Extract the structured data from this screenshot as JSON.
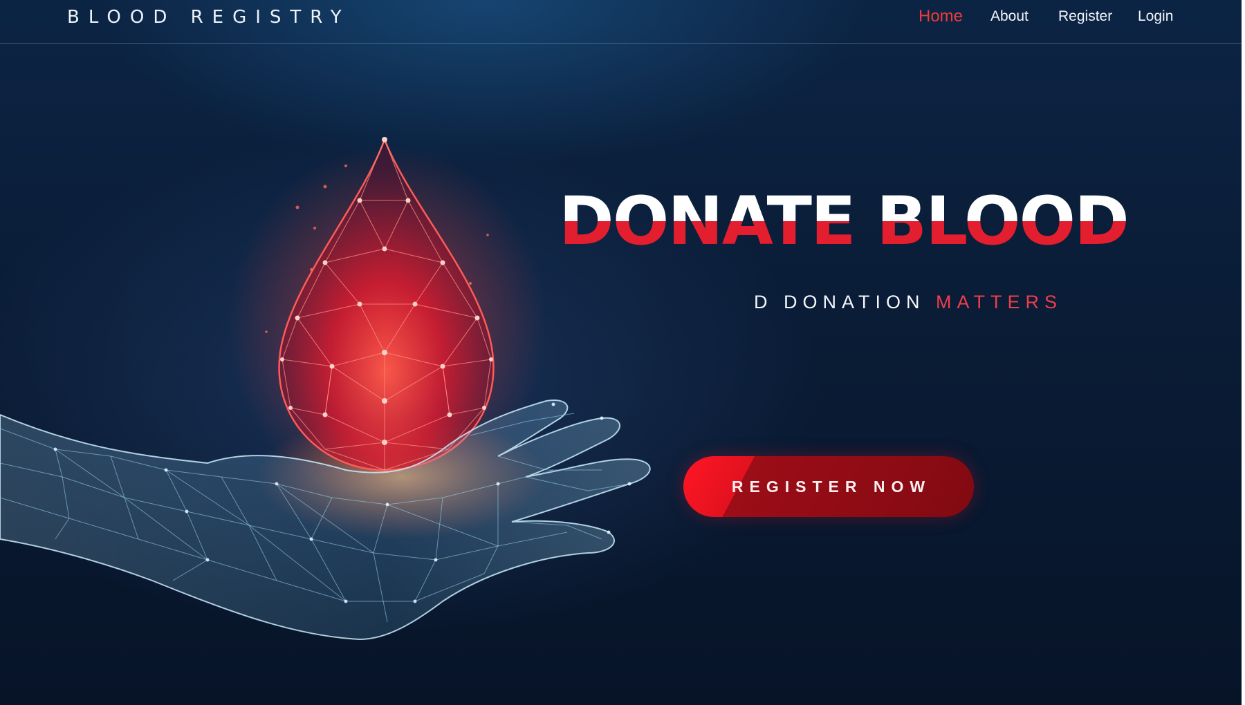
{
  "brand": "BLOOD REGISTRY",
  "nav": {
    "home": "Home",
    "about": "About",
    "register": "Register",
    "login": "Login",
    "active": "Home"
  },
  "hero": {
    "headline": "DONATE BLOOD",
    "tagline_part1": "D",
    "tagline_part2": "DONATION",
    "tagline_part3": "MATTERS",
    "cta": "REGISTER NOW"
  },
  "icons": {
    "illustration": "blood-drop-hand-icon"
  },
  "colors": {
    "accent_red": "#e31e2e",
    "nav_active": "#f03a38",
    "background": "#0a1c36",
    "wireframe": "#9fd8f2"
  }
}
